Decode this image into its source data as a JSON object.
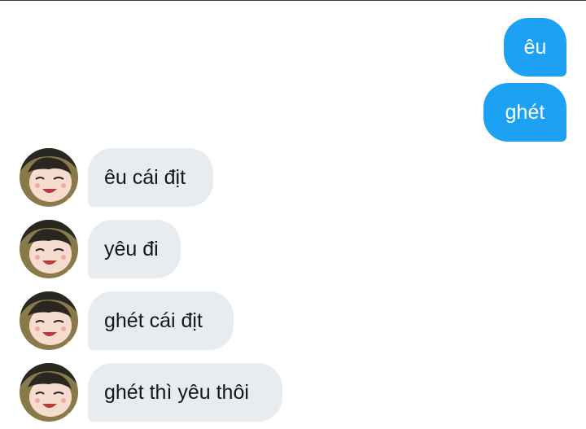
{
  "conversation": {
    "messages": [
      {
        "direction": "outgoing",
        "text": "êu"
      },
      {
        "direction": "outgoing",
        "text": "ghét"
      },
      {
        "direction": "incoming",
        "text": "êu cái địt"
      },
      {
        "direction": "incoming",
        "text": "yêu đi"
      },
      {
        "direction": "incoming",
        "text": "ghét cái địt"
      },
      {
        "direction": "incoming",
        "text": "ghét thì yêu thôi"
      }
    ],
    "avatar_icon": "anime-character-avatar"
  },
  "colors": {
    "outgoing_bubble": "#1da1f2",
    "incoming_bubble": "#e6ecf0",
    "incoming_text": "#14171a",
    "outgoing_text": "#ffffff"
  }
}
